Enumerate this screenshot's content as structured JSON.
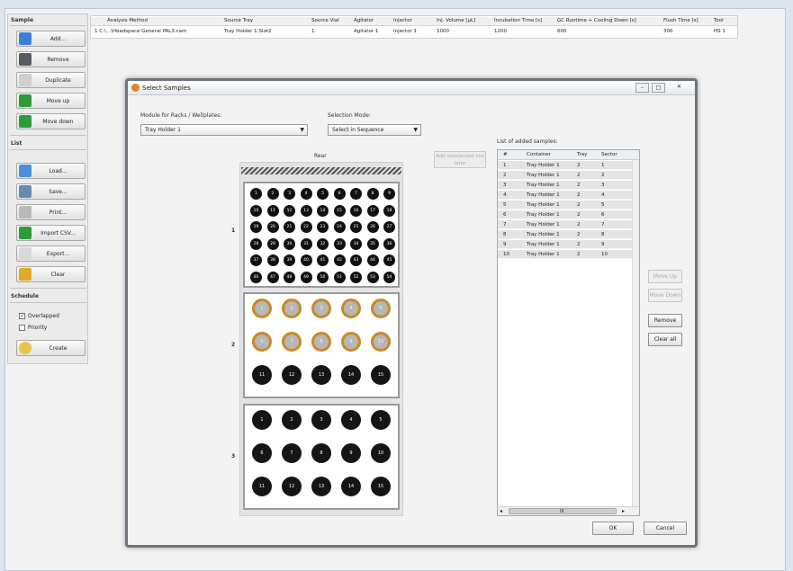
{
  "left_panel": {
    "samples_title": "Sample",
    "samples_buttons": [
      {
        "label": "Add...",
        "icon": "add-arrow-icon",
        "color": "#3d7fd6"
      },
      {
        "label": "Remove",
        "icon": "remove-icon",
        "color": "#555d66"
      },
      {
        "label": "Duplicate",
        "icon": "duplicate-icon",
        "color": "#cfcfcf"
      },
      {
        "label": "Move up",
        "icon": "arrow-up-icon",
        "color": "#2f9a3a"
      },
      {
        "label": "Move down",
        "icon": "arrow-down-icon",
        "color": "#2f9a3a"
      }
    ],
    "list_title": "List",
    "list_buttons": [
      {
        "label": "Load...",
        "icon": "load-icon",
        "color": "#4d8fd9"
      },
      {
        "label": "Save...",
        "icon": "save-icon",
        "color": "#6a8bb0"
      },
      {
        "label": "Print...",
        "icon": "print-icon",
        "color": "#b9b9b9"
      },
      {
        "label": "Import CSV...",
        "icon": "import-csv-icon",
        "color": "#2f9a3a"
      },
      {
        "label": "Export...",
        "icon": "export-icon",
        "color": "#d9d9d9"
      },
      {
        "label": "Clear",
        "icon": "clear-icon",
        "color": "#e2a92b"
      }
    ],
    "schedule_title": "Schedule",
    "overlapped_label": "Overlapped",
    "overlapped_checked": true,
    "priority_label": "Priority",
    "priority_checked": false,
    "create_label": "Create"
  },
  "top_table": {
    "headers": [
      "Analysis Method",
      "Source Tray",
      "Source Vial",
      "Agitator",
      "Injector",
      "Inj. Volume [µL]",
      "Incubation Time [s]",
      "GC Runtime + Cooling Down [s]",
      "Flush Time [s]",
      "Tool"
    ],
    "row": [
      "1  C:\\...\\Headspace General PAL3.cam",
      "Tray Holder 1:Slot2",
      "1",
      "Agitator 1",
      "Injector 1",
      "1000",
      "1200",
      "600",
      "300",
      "HS 1"
    ]
  },
  "dialog": {
    "title": "Select Samples",
    "module_label": "Module for Racks / Wellplates:",
    "module_value": "Tray Holder 1",
    "mode_label": "Selection Mode:",
    "mode_value": "Select in Sequence",
    "rear_label": "Rear",
    "add_unselected_label": "Add unselected vial later",
    "list_label": "List of added samples:",
    "list_headers": [
      "#",
      "Container",
      "Tray",
      "Sector"
    ],
    "list_rows": [
      [
        "1",
        "Tray Holder 1",
        "2",
        "1"
      ],
      [
        "2",
        "Tray Holder 1",
        "2",
        "2"
      ],
      [
        "3",
        "Tray Holder 1",
        "2",
        "3"
      ],
      [
        "4",
        "Tray Holder 1",
        "2",
        "4"
      ],
      [
        "5",
        "Tray Holder 1",
        "2",
        "5"
      ],
      [
        "6",
        "Tray Holder 1",
        "2",
        "6"
      ],
      [
        "7",
        "Tray Holder 1",
        "2",
        "7"
      ],
      [
        "8",
        "Tray Holder 1",
        "2",
        "8"
      ],
      [
        "9",
        "Tray Holder 1",
        "2",
        "9"
      ],
      [
        "10",
        "Tray Holder 1",
        "2",
        "10"
      ]
    ],
    "move_up_label": "Move Up",
    "move_down_label": "Move Down",
    "remove_label": "Remove",
    "clear_all_label": "Clear all",
    "ok_label": "OK",
    "cancel_label": "Cancel",
    "scroll_label": "III",
    "tray_numbers": [
      "1",
      "2",
      "3"
    ],
    "tray1_vials": [
      "1",
      "2",
      "3",
      "4",
      "5",
      "6",
      "7",
      "8",
      "9",
      "10",
      "11",
      "12",
      "13",
      "14",
      "15",
      "16",
      "17",
      "18",
      "19",
      "20",
      "21",
      "22",
      "23",
      "24",
      "25",
      "26",
      "27",
      "28",
      "29",
      "30",
      "31",
      "32",
      "33",
      "34",
      "35",
      "36",
      "37",
      "38",
      "39",
      "40",
      "41",
      "42",
      "43",
      "44",
      "45",
      "46",
      "47",
      "48",
      "49",
      "50",
      "51",
      "52",
      "53",
      "54"
    ],
    "tray2_vials": [
      "1",
      "2",
      "3",
      "4",
      "5",
      "6",
      "7",
      "8",
      "9",
      "10",
      "11",
      "12",
      "13",
      "14",
      "15"
    ],
    "tray2_selected_count": 10,
    "tray3_vials": [
      "1",
      "2",
      "3",
      "4",
      "5",
      "6",
      "7",
      "8",
      "9",
      "10",
      "11",
      "12",
      "13",
      "14",
      "15"
    ],
    "selected_ring_color": "#c98a25"
  }
}
